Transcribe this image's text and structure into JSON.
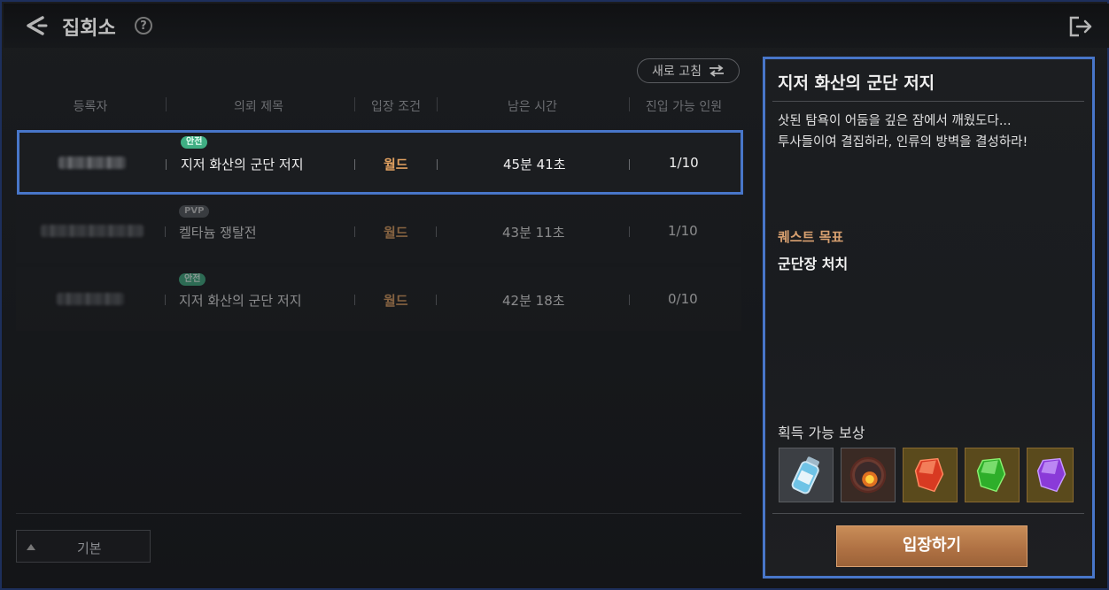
{
  "header": {
    "title": "집회소",
    "help_glyph": "?"
  },
  "toolbar": {
    "refresh_label": "새로 고침"
  },
  "table": {
    "columns": [
      "등록자",
      "의뢰 제목",
      "입장 조건",
      "남은 시간",
      "진입 가능 인원"
    ],
    "rows": [
      {
        "badge": "안전",
        "badge_type": "safe",
        "title": "지저 화산의 군단 저지",
        "condition": "월드",
        "time": "45분 41초",
        "capacity": "1/10",
        "selected": true
      },
      {
        "badge": "PVP",
        "badge_type": "pvp",
        "title": "켈타늄 쟁탈전",
        "condition": "월드",
        "time": "43분 11초",
        "capacity": "1/10",
        "selected": false
      },
      {
        "badge": "안전",
        "badge_type": "safe",
        "title": "지저 화산의 군단 저지",
        "condition": "월드",
        "time": "42분 18초",
        "capacity": "0/10",
        "selected": false
      }
    ]
  },
  "sort": {
    "label": "기본"
  },
  "detail": {
    "title": "지저 화산의 군단 저지",
    "description": [
      "삿된 탐욕이 어둠을 깊은 잠에서 깨웠도다...",
      "투사들이여 결집하라, 인류의 방벽을 결성하라!"
    ],
    "goal_label": "퀘스트 목표",
    "goal": "군단장 처치",
    "reward_label": "획득 가능 보상",
    "rewards": [
      "potion-vial-icon",
      "fire-orb-icon",
      "red-crystal-icon",
      "green-crystal-icon",
      "purple-crystal-icon"
    ],
    "enter_label": "입장하기"
  },
  "colors": {
    "accent_border": "#4876c9",
    "safe_badge": "#3fae83",
    "condition": "#e0a060",
    "enter_button": "#b07244"
  }
}
